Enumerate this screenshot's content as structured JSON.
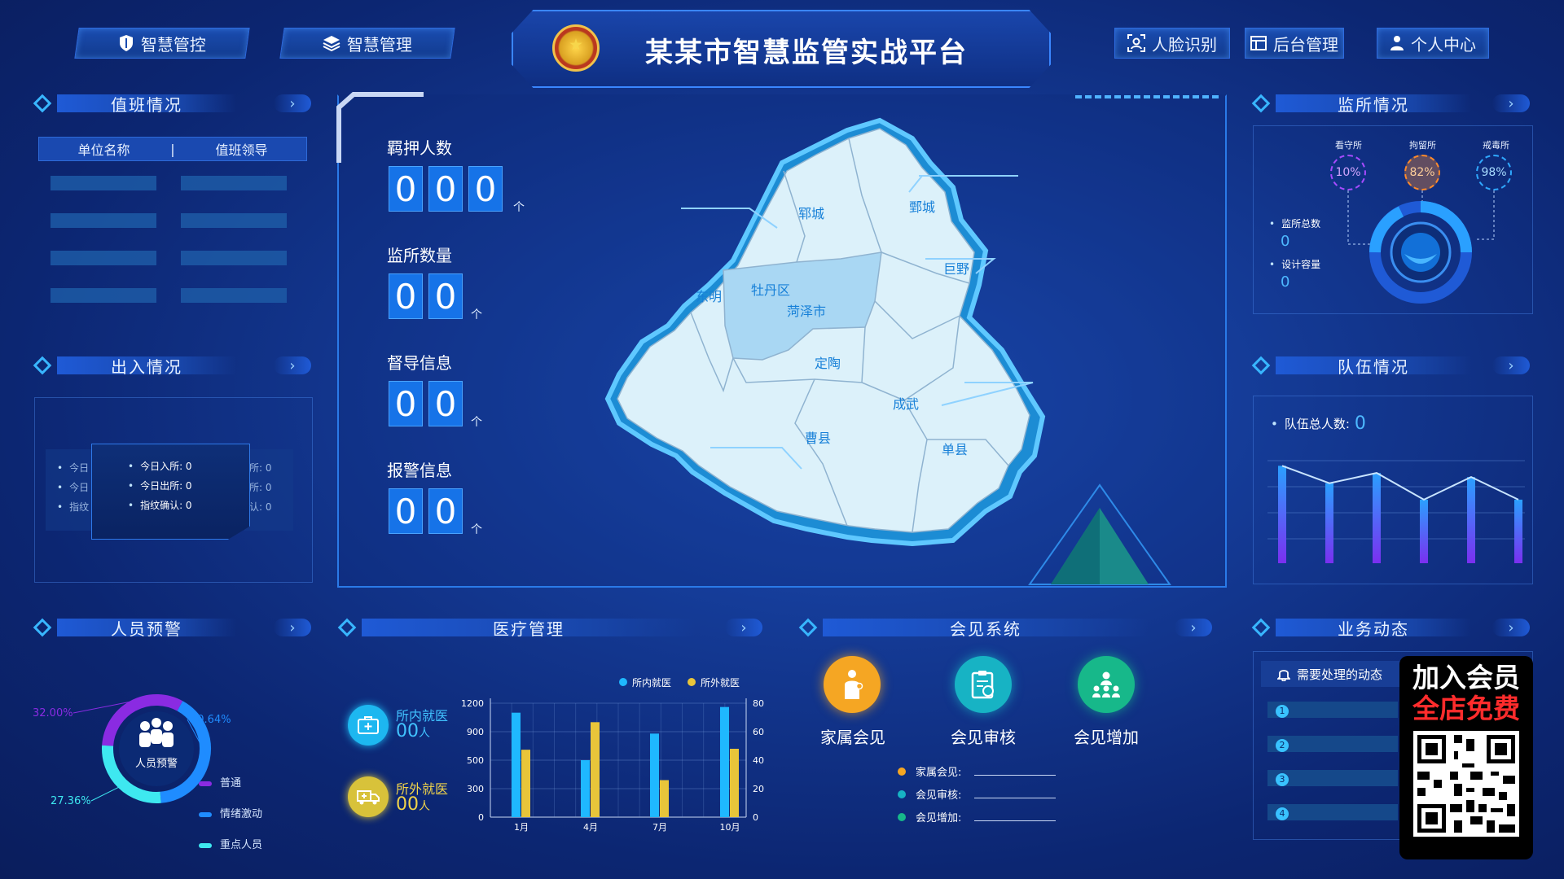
{
  "header": {
    "title": "某某市智慧监管实战平台",
    "nav_left": [
      "智慧管控",
      "智慧管理"
    ],
    "nav_right": [
      "人脸识别",
      "后台管理",
      "个人中心"
    ]
  },
  "duty": {
    "title": "值班情况",
    "col1": "单位名称",
    "col2": "值班领导",
    "separator": "|"
  },
  "inout": {
    "title": "出入情况",
    "ghost_left": [
      "今日",
      "今日",
      "指纹"
    ],
    "ghost_right": [
      "所: 0",
      "所: 0",
      "认: 0"
    ],
    "items": [
      "今日入所: 0",
      "今日出所: 0",
      "指纹确认: 0"
    ]
  },
  "stats": [
    {
      "label": "羁押人数",
      "digits": [
        "0",
        "0",
        "0"
      ],
      "unit": "个"
    },
    {
      "label": "监所数量",
      "digits": [
        "0",
        "0"
      ],
      "unit": "个"
    },
    {
      "label": "督导信息",
      "digits": [
        "0",
        "0"
      ],
      "unit": "个"
    },
    {
      "label": "报警信息",
      "digits": [
        "0",
        "0"
      ],
      "unit": "个"
    }
  ],
  "map": {
    "districts": [
      "郓城",
      "鄄城",
      "东明",
      "牡丹区",
      "菏泽市",
      "巨野",
      "定陶",
      "成武",
      "曹县",
      "单县"
    ]
  },
  "prison": {
    "title": "监所情况",
    "gauges": [
      {
        "name": "看守所",
        "value": "10%",
        "color": "#a64bff"
      },
      {
        "name": "拘留所",
        "value": "82%",
        "color": "#ff8a2b"
      },
      {
        "name": "戒毒所",
        "value": "98%",
        "color": "#2fa8ff"
      }
    ],
    "total_label": "监所总数",
    "total_value": "0",
    "capacity_label": "设计容量",
    "capacity_value": "0"
  },
  "team": {
    "title": "队伍情况",
    "total_label": "队伍总人数:",
    "total_value": "0"
  },
  "team_chart": {
    "type": "bar",
    "values": [
      95,
      78,
      88,
      62,
      84,
      62
    ]
  },
  "warning": {
    "title": "人员预警",
    "center_label": "人员预警",
    "legend": [
      "普通",
      "情绪激动",
      "重点人员"
    ]
  },
  "warning_chart": {
    "type": "pie",
    "labels": [
      "普通",
      "情绪激动",
      "重点人员"
    ],
    "values": [
      32.0,
      40.64,
      27.36
    ],
    "value_labels": [
      "32.00%",
      "40.64%",
      "27.36%"
    ],
    "colors": [
      "#8a2be2",
      "#1f8cff",
      "#3ee8f0"
    ]
  },
  "medical": {
    "title": "医疗管理",
    "inside_label": "所内就医",
    "inside_value": "00",
    "inside_unit": "人",
    "outside_label": "所外就医",
    "outside_value": "00",
    "outside_unit": "人",
    "legend": [
      "所内就医",
      "所外就医"
    ]
  },
  "medical_chart": {
    "type": "bar",
    "categories": [
      "1月",
      "4月",
      "7月",
      "10月"
    ],
    "left_ticks": [
      "1200",
      "900",
      "500",
      "300",
      "0"
    ],
    "right_ticks": [
      "80",
      "60",
      "40",
      "20",
      "0"
    ],
    "series": [
      {
        "name": "所内就医",
        "values": [
          1100,
          600,
          880,
          1160
        ],
        "color": "#1fb8ff"
      },
      {
        "name": "所外就医",
        "values": [
          710,
          1000,
          390,
          720
        ],
        "color": "#e8c53a"
      }
    ],
    "ylim": [
      0,
      1200
    ]
  },
  "visit": {
    "title": "会见系统",
    "buttons": [
      "家属会见",
      "会见审核",
      "会见增加"
    ],
    "stats": [
      "家属会见:",
      "会见审核:",
      "会见增加:"
    ]
  },
  "business": {
    "title": "业务动态",
    "notice": "需要处理的动态",
    "rows": [
      "1",
      "2",
      "3",
      "4"
    ]
  },
  "promo": {
    "line1": "加入会员",
    "line2": "全店免费"
  },
  "colors": {
    "accent": "#2fa8ff",
    "digit_bg": "#1673e8",
    "bg_dark": "#0a1d5c"
  }
}
